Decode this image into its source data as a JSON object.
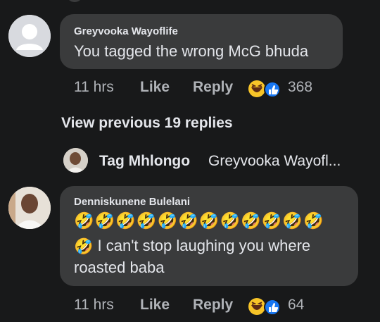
{
  "comments": [
    {
      "author": "Greyvooka Wayoflife",
      "text": "You tagged the wrong McG bhuda",
      "time": "11 hrs",
      "like_label": "Like",
      "reply_label": "Reply",
      "reaction_count": "368",
      "reaction_icons": [
        "laughing-emoji-icon",
        "like-thumb-icon"
      ]
    },
    {
      "author": "Denniskunene Bulelani",
      "emoji_row": "🤣🤣🤣🤣🤣🤣🤣🤣🤣🤣🤣🤣",
      "line1_emoji": "🤣",
      "line1": "I can't stop laughing you where",
      "line2": "roasted baba",
      "time": "11 hrs",
      "like_label": "Like",
      "reply_label": "Reply",
      "reaction_count": "64",
      "reaction_icons": [
        "laughing-emoji-icon",
        "like-thumb-icon"
      ]
    }
  ],
  "view_previous_replies": "View previous 19 replies",
  "reply_preview": {
    "name": "Tag Mhlongo",
    "snippet": "Greyvooka Wayofl..."
  },
  "colors": {
    "background": "#18191a",
    "bubble": "#3a3b3c",
    "text": "#e4e6eb",
    "meta": "#b0b3b8",
    "like_blue": "#1877f2",
    "emoji_yellow": "#f7c428"
  }
}
